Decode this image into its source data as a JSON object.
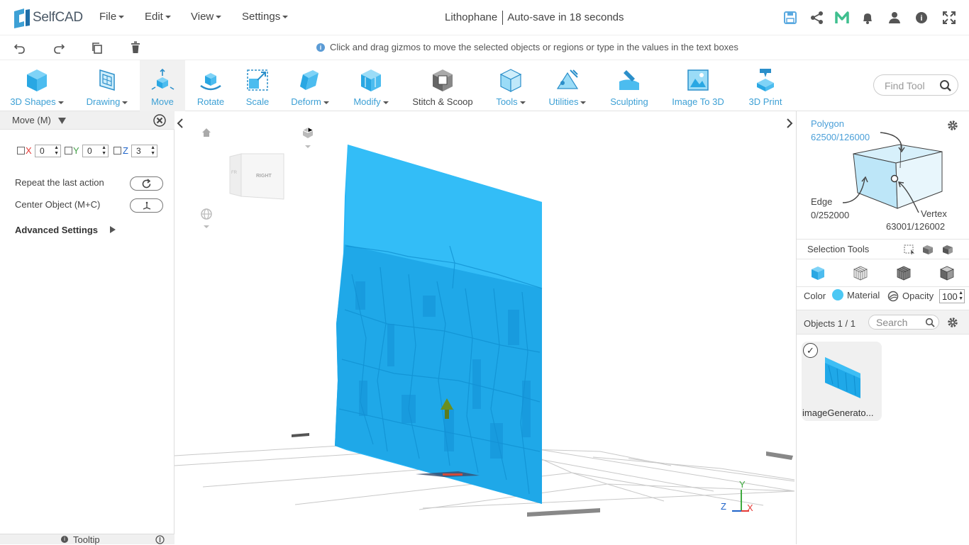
{
  "app": {
    "name": "SelfCAD"
  },
  "menus": {
    "file": "File",
    "edit": "Edit",
    "view": "View",
    "settings": "Settings"
  },
  "project": {
    "name": "Lithophane",
    "autosave": "Auto-save in 18 seconds"
  },
  "hint": "Click and drag gizmos to move the selected objects or regions or type in the values in the text boxes",
  "toolbar": {
    "tools": [
      {
        "label": "3D Shapes",
        "dropdown": true,
        "icon": "cube-icon"
      },
      {
        "label": "Drawing",
        "dropdown": true,
        "icon": "drawing-icon"
      },
      {
        "label": "Move",
        "dropdown": false,
        "active": true,
        "icon": "move-icon"
      },
      {
        "label": "Rotate",
        "dropdown": false,
        "icon": "rotate-icon"
      },
      {
        "label": "Scale",
        "dropdown": false,
        "icon": "scale-icon"
      },
      {
        "label": "Deform",
        "dropdown": true,
        "icon": "deform-icon"
      },
      {
        "label": "Modify",
        "dropdown": true,
        "icon": "modify-icon"
      },
      {
        "label": "Stitch & Scoop",
        "dropdown": false,
        "icon": "stitch-scoop-icon"
      },
      {
        "label": "Tools",
        "dropdown": true,
        "icon": "tools-icon"
      },
      {
        "label": "Utilities",
        "dropdown": true,
        "icon": "utilities-icon"
      },
      {
        "label": "Sculpting",
        "dropdown": false,
        "icon": "sculpting-icon"
      },
      {
        "label": "Image To 3D",
        "dropdown": false,
        "icon": "image-to-3d-icon"
      },
      {
        "label": "3D Print",
        "dropdown": false,
        "icon": "3d-print-icon"
      }
    ],
    "find_placeholder": "Find Tool"
  },
  "move_panel": {
    "title": "Move (M)",
    "x_label": "X",
    "x_value": "0",
    "y_label": "Y",
    "y_value": "0",
    "z_label": "Z",
    "z_value": "3",
    "repeat_label": "Repeat the last action",
    "center_label": "Center Object (M+C)",
    "advanced_label": "Advanced Settings",
    "tooltip_label": "Tooltip"
  },
  "viewcube": {
    "right": "RIGHT",
    "front": "FR"
  },
  "axes": {
    "x": "X",
    "y": "Y",
    "z": "Z"
  },
  "selection": {
    "polygon_label": "Polygon",
    "polygon_count": "62500/126000",
    "edge_label": "Edge",
    "edge_count": "0/252000",
    "vertex_label": "Vertex",
    "vertex_count": "63001/126002",
    "tools_label": "Selection Tools"
  },
  "material": {
    "color_label": "Color",
    "material_label": "Material",
    "opacity_label": "Opacity",
    "opacity_value": "100",
    "color": "#4cc8f4"
  },
  "objects": {
    "header": "Objects 1 / 1",
    "search_placeholder": "Search",
    "items": [
      {
        "name": "imageGenerato..."
      }
    ]
  },
  "colors": {
    "accent": "#3da0d5",
    "model": "#29b6f6"
  }
}
